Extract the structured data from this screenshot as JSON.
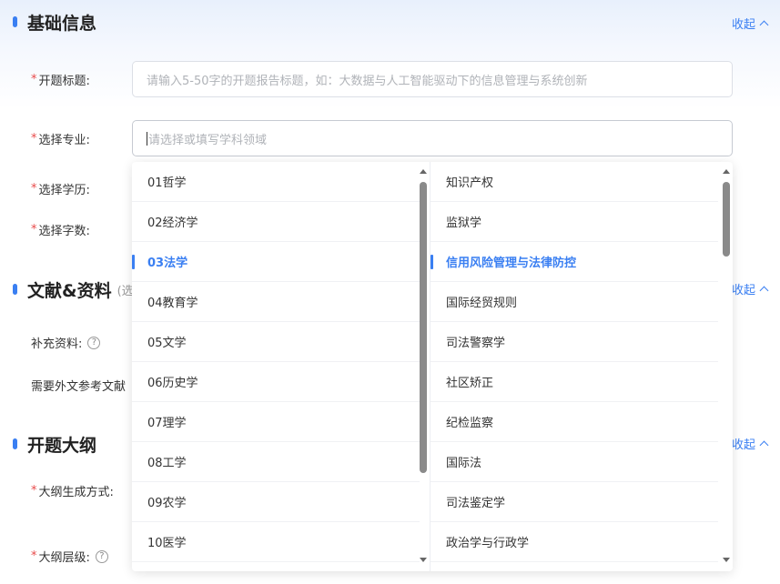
{
  "sections": {
    "basic": {
      "title": "基础信息",
      "collapse": "收起"
    },
    "refs": {
      "title": "文献&资料",
      "sub": "(选",
      "collapse": "收起"
    },
    "outline": {
      "title": "开题大纲",
      "collapse": "收起"
    }
  },
  "form": {
    "title_label": "开题标题:",
    "title_placeholder": "请输入5-50字的开题报告标题，如：大数据与人工智能驱动下的信息管理与系统创新",
    "major_label": "选择专业:",
    "major_placeholder": "请选择或填写学科领域",
    "degree_label": "选择学历:",
    "words_label": "选择字数:",
    "supplement_label": "补充资料:",
    "foreign_label": "需要外文参考文献",
    "outline_mode_label": "大纲生成方式:",
    "outline_level_label": "大纲层级:",
    "required_mark": "*",
    "help_mark": "?"
  },
  "dropdown": {
    "left": [
      {
        "label": "01哲学"
      },
      {
        "label": "02经济学"
      },
      {
        "label": "03法学",
        "active": true
      },
      {
        "label": "04教育学"
      },
      {
        "label": "05文学"
      },
      {
        "label": "06历史学"
      },
      {
        "label": "07理学"
      },
      {
        "label": "08工学"
      },
      {
        "label": "09农学"
      },
      {
        "label": "10医学"
      }
    ],
    "right": [
      {
        "label": "知识产权"
      },
      {
        "label": "监狱学"
      },
      {
        "label": "信用风险管理与法律防控",
        "active": true
      },
      {
        "label": "国际经贸规则"
      },
      {
        "label": "司法警察学"
      },
      {
        "label": "社区矫正"
      },
      {
        "label": "纪检监察"
      },
      {
        "label": "国际法"
      },
      {
        "label": "司法鉴定学"
      },
      {
        "label": "政治学与行政学"
      }
    ]
  },
  "colors": {
    "accent": "#3a7ff2",
    "required": "#e84a4a"
  }
}
